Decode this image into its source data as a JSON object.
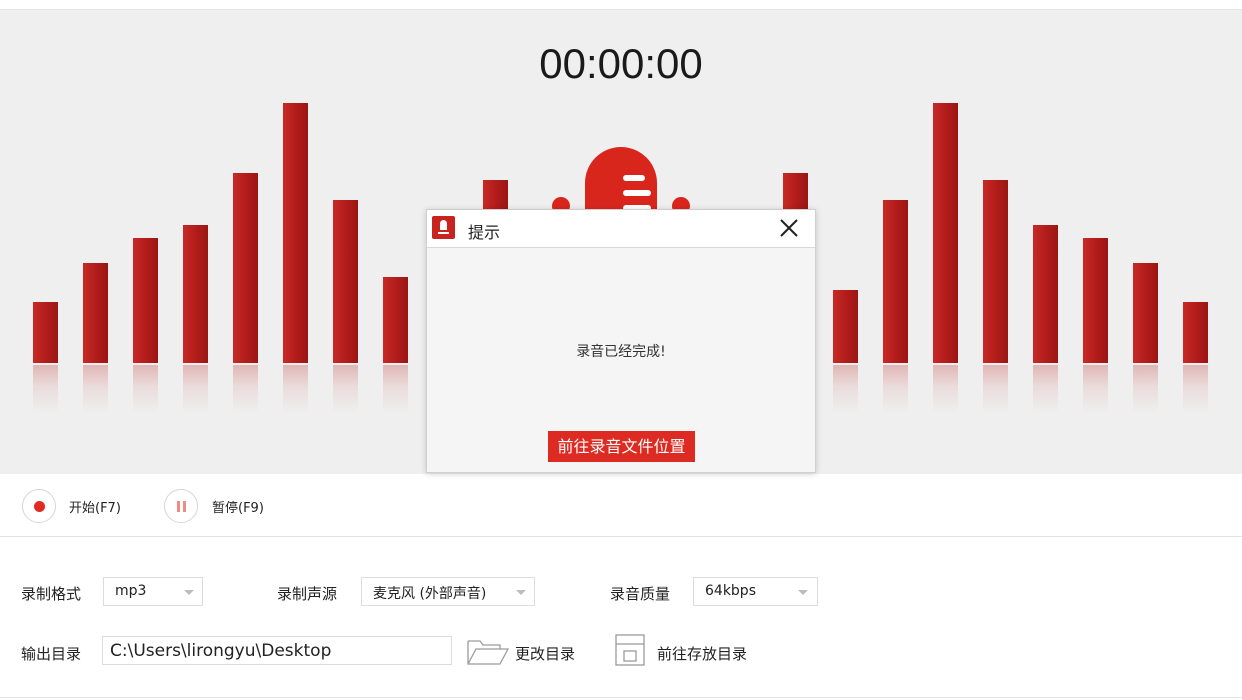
{
  "timer": "00:00:00",
  "dialog": {
    "title": "提示",
    "message": "录音已经完成!",
    "button_label": "前往录音文件位置"
  },
  "controls": {
    "start_label": "开始(F7)",
    "pause_label": "暂停(F9)"
  },
  "settings": {
    "format_label": "录制格式",
    "format_value": "mp3",
    "source_label": "录制声源",
    "source_value": "麦克风 (外部声音)",
    "quality_label": "录音质量",
    "quality_value": "64kbps",
    "output_label": "输出目录",
    "output_path": "C:\\Users\\lirongyu\\Desktop",
    "change_dir_label": "更改目录",
    "open_dir_label": "前往存放目录"
  },
  "colors": {
    "accent": "#dd2a22",
    "bar_dark": "#9c1614",
    "bar_light": "#c82a25",
    "panel_bg": "#efefef"
  },
  "icons": [
    "microphone-icon",
    "close-icon",
    "record-icon",
    "pause-icon",
    "folder-icon",
    "save-icon",
    "chevron-down-icon"
  ]
}
